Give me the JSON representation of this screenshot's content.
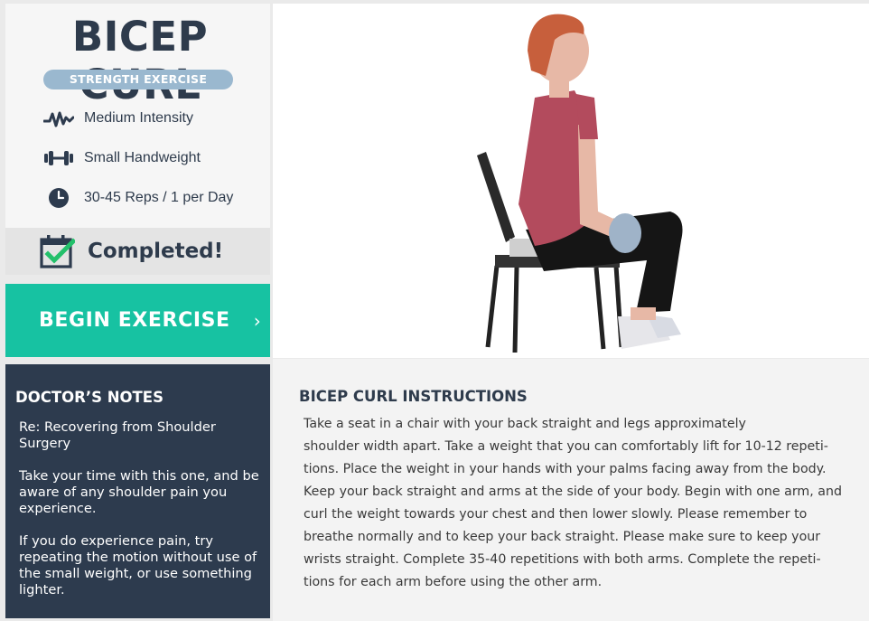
{
  "exercise": {
    "title": "BICEP CURL",
    "category": "STRENGTH EXERCISE",
    "intensity": "Medium Intensity",
    "equipment": "Small Handweight",
    "reps": "30-45 Reps / 1 per Day",
    "completed_label": "Completed!",
    "begin_label": "BEGIN EXERCISE"
  },
  "icons": {
    "intensity": "pulse-icon",
    "equipment": "dumbbell-icon",
    "reps": "clock-icon",
    "completed": "calendar-check-icon",
    "begin": "chevron-right-icon"
  },
  "doctor_notes": {
    "title": "DOCTOR’S NOTES",
    "paragraphs": [
      "Re: Recovering from Shoulder Surgery",
      "Take your time with this one, and be aware of any shoulder pain you experience.",
      "If you do experience pain, try repeating the motion without use of the small weight, or use something lighter."
    ]
  },
  "instructions": {
    "title": "BICEP CURL INSTRUCTIONS",
    "lines": [
      "Take a seat in a chair with your back straight and legs approximately",
      "shoulder width apart. Take a weight that you can comfortably lift for 10-12 repeti-",
      "tions. Place the weight in your hands with your palms facing away from the body.",
      "Keep your back straight and arms at the side of your body. Begin with one arm, and",
      "curl the weight towards your chest and then lower slowly. Please remember to",
      "breathe normally and to keep your back straight. Please make sure to keep your",
      "wrists straight. Complete 35-40 repetitions with both arms. Complete the repeti-",
      "tions for each arm before using the other arm."
    ]
  },
  "colors": {
    "navy": "#2d3b4e",
    "teal": "#17c2a2",
    "badge": "#9ab8cf",
    "check_green": "#23c06b"
  }
}
